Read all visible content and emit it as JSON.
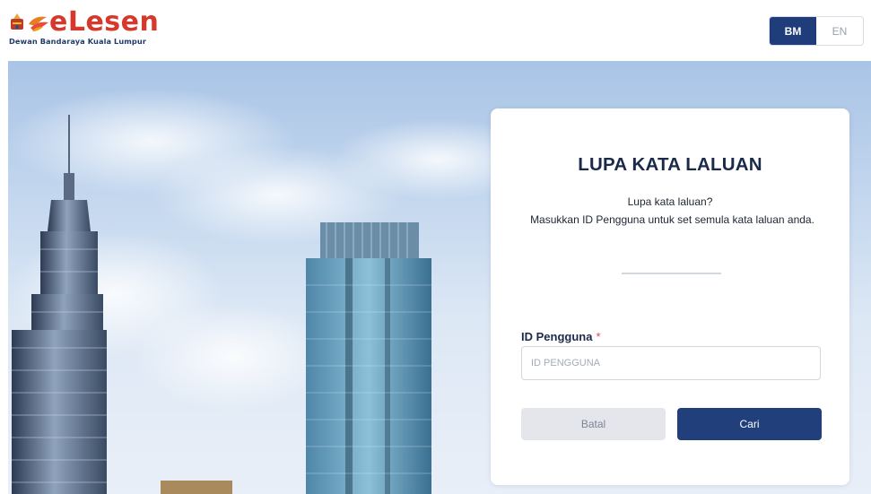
{
  "header": {
    "logo_word": "eLesen",
    "logo_tagline": "Dewan Bandaraya Kuala Lumpur",
    "lang": {
      "bm": "BM",
      "en": "EN",
      "active": "BM"
    }
  },
  "card": {
    "title": "LUPA KATA LALUAN",
    "subtitle_line1": "Lupa kata laluan?",
    "subtitle_line2": "Masukkan ID Pengguna untuk set semula kata laluan anda.",
    "field": {
      "label": "ID Pengguna",
      "required_mark": "*",
      "placeholder": "ID PENGGUNA",
      "value": ""
    },
    "cancel_label": "Batal",
    "search_label": "Cari"
  },
  "colors": {
    "brand_primary": "#213f7b",
    "logo_red": "#d6392c",
    "required": "#e0475c"
  }
}
